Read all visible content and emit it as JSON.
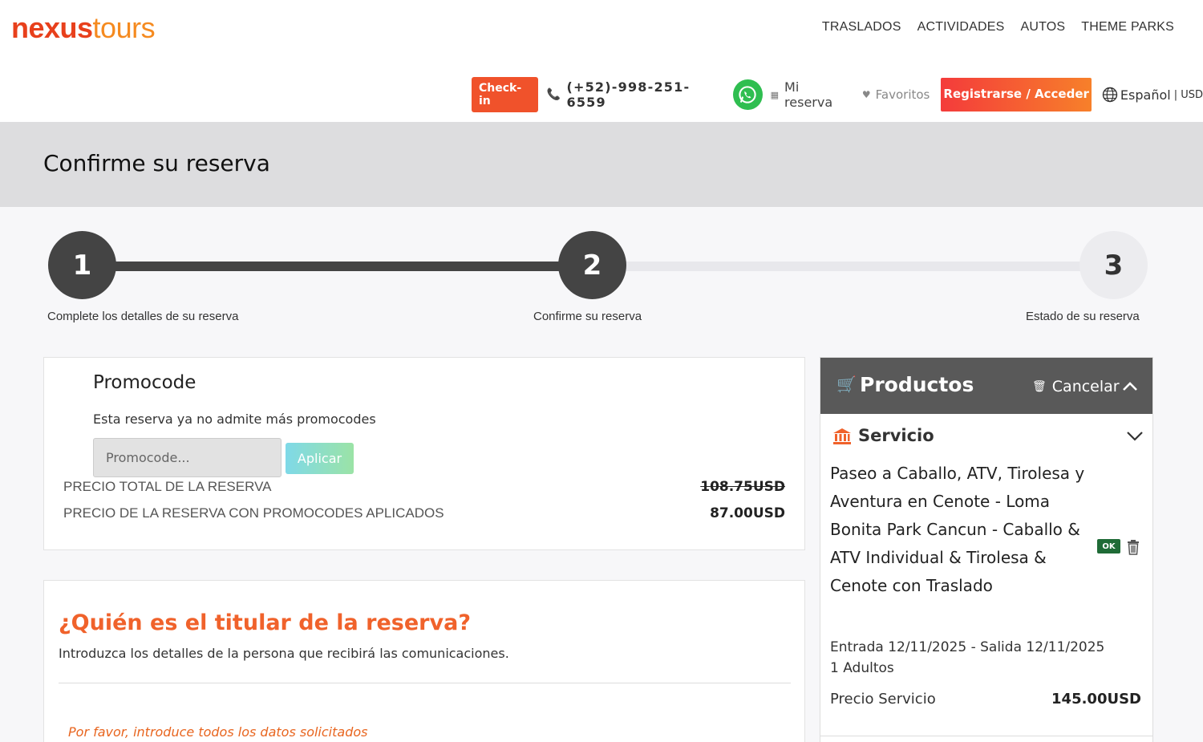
{
  "header": {
    "logo": {
      "part1": "nexus",
      "part2": "tours"
    },
    "nav": [
      "TRASLADOS",
      "ACTIVIDADES",
      "AUTOS",
      "THEME PARKS"
    ],
    "checkin": "Check-in",
    "phone": "(+52)-998-251-6559",
    "my_reservation": "Mi reserva",
    "favorites": "Favoritos",
    "register": "Registrarse / Acceder",
    "language": "Español",
    "currency": "| USD"
  },
  "page": {
    "title": "Confirme su reserva"
  },
  "stepper": {
    "steps": [
      {
        "number": "1",
        "label": "Complete los detalles de su reserva"
      },
      {
        "number": "2",
        "label": "Confirme su reserva"
      },
      {
        "number": "3",
        "label": "Estado de su reserva"
      }
    ],
    "current": 2
  },
  "promo": {
    "title": "Promocode",
    "note": "Esta reserva ya no admite más promocodes",
    "input_placeholder": "Promocode...",
    "apply": "Aplicar",
    "total_label": "PRECIO TOTAL DE LA RESERVA",
    "total_value": "108.75USD",
    "promo_label": "PRECIO DE LA RESERVA CON PROMOCODES APLICADOS",
    "promo_value": "87.00USD"
  },
  "holder": {
    "title": "¿Quién es el titular de la reserva?",
    "description": "Introduzca los detalles de la persona que recibirá las comunicaciones.",
    "warning": "Por favor, introduce todos los datos solicitados"
  },
  "products": {
    "title": "Productos",
    "cancel": "Cancelar",
    "service": {
      "title": "Servicio",
      "name": "Paseo a Caballo, ATV, Tirolesa y Aventura en Cenote - Loma Bonita Park Cancun - Caballo & ATV Individual & Tirolesa & Cenote con Traslado",
      "badge": "OK",
      "dates": "Entrada 12/11/2025 - Salida 12/11/2025",
      "adults": "1 Adultos",
      "price_label": "Precio Servicio",
      "price_value": "145.00USD"
    }
  },
  "colors": {
    "brand_red": "#e8401c",
    "brand_orange": "#f58a1f",
    "ok_green": "#1f6b36",
    "title_orange": "#f0622b"
  }
}
